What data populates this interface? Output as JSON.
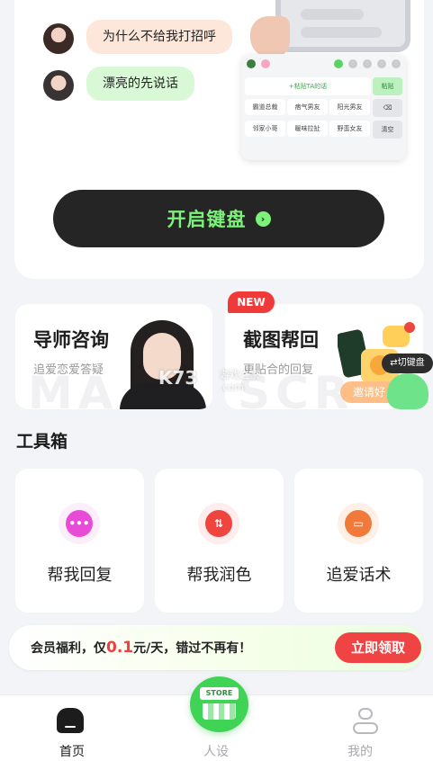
{
  "hero": {
    "chat": [
      {
        "avatar": "female-avatar",
        "text": "为什么不给我打招呼"
      },
      {
        "avatar": "male-avatar",
        "text": "漂亮的先说话"
      }
    ],
    "keyboard_preview": {
      "paste_hint": "+粘贴TA的话",
      "paste_button": "粘贴",
      "clear_button": "清空",
      "cells": [
        "霸道总裁",
        "痞气男友",
        "阳光男友",
        "邻家小哥",
        "暖味拉扯",
        "野蛮女友"
      ]
    },
    "start_button": "开启键盘",
    "accent_color": "#7df27a"
  },
  "features": {
    "mentor": {
      "title": "导师咨询",
      "subtitle": "追爱恋爱答疑",
      "bg_text": "MA"
    },
    "screenshot": {
      "badge": "NEW",
      "title": "截图帮回",
      "subtitle": "更贴合的回复",
      "bg_text": "SCR",
      "invite_button": "邀请好",
      "switch_keyboard": "⇄切键盘"
    }
  },
  "watermark": {
    "logo": "K73",
    "text": "游戏之家",
    "domain": ".com"
  },
  "toolbox": {
    "title": "工具箱",
    "tools": [
      {
        "label": "帮我回复",
        "icon": "chat-bubble-icon",
        "color": "#e94bd8"
      },
      {
        "label": "帮我润色",
        "icon": "polish-icon",
        "color": "#f0443f"
      },
      {
        "label": "追爱话术",
        "icon": "script-icon",
        "color": "#f07a3a"
      }
    ]
  },
  "promo": {
    "prefix": "会员福利，仅",
    "price": "0.1",
    "suffix": "元/天，错过不再有！",
    "button": "立即领取",
    "button_color": "#f04444"
  },
  "tabbar": {
    "tabs": [
      {
        "label": "首页",
        "icon": "home-icon",
        "active": true
      },
      {
        "label": "人设",
        "icon": "store-icon",
        "active": false
      },
      {
        "label": "我的",
        "icon": "profile-icon",
        "active": false
      }
    ],
    "store_sign": "STORE"
  }
}
